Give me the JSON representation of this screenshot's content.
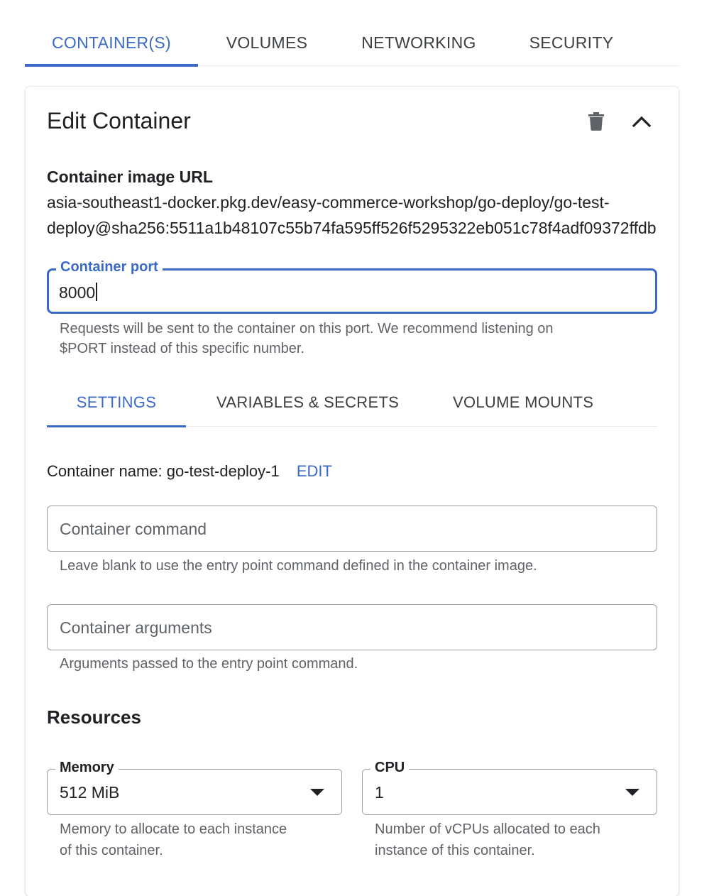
{
  "top_tabs": {
    "container": "CONTAINER(S)",
    "volumes": "VOLUMES",
    "networking": "NETWORKING",
    "security": "SECURITY"
  },
  "card": {
    "title": "Edit Container",
    "delete_icon": "trash-icon",
    "collapse_icon": "chevron-up-icon"
  },
  "image": {
    "label": "Container image URL",
    "url_line1": "asia-southeast1-docker.pkg.dev/easy-commerce-workshop/go-deploy/go-test-",
    "url_line2": "deploy@sha256:5511a1b48107c55b74fa595ff526f5295322eb051c78f4adf09372ffdb"
  },
  "port": {
    "label": "Container port",
    "value": "8000",
    "helper_line1": "Requests will be sent to the container on this port. We recommend listening on",
    "helper_line2": "$PORT instead of this specific number."
  },
  "sub_tabs": {
    "settings": "SETTINGS",
    "variables": "VARIABLES & SECRETS",
    "volume_mounts": "VOLUME MOUNTS"
  },
  "container_name": {
    "text": "Container name: go-test-deploy-1",
    "edit": "EDIT"
  },
  "command": {
    "placeholder": "Container command",
    "helper": "Leave blank to use the entry point command defined in the container image."
  },
  "arguments": {
    "placeholder": "Container arguments",
    "helper": "Arguments passed to the entry point command."
  },
  "resources": {
    "heading": "Resources",
    "memory": {
      "label": "Memory",
      "value": "512 MiB",
      "helper_line1": "Memory to allocate to each instance",
      "helper_line2": "of this container."
    },
    "cpu": {
      "label": "CPU",
      "value": "1",
      "helper_line1": "Number of vCPUs allocated to each",
      "helper_line2": "instance of this container."
    }
  },
  "colors": {
    "accent": "#3b6ac6",
    "text": "#202124",
    "helper": "#5f6368",
    "border": "#9aa0a6"
  }
}
